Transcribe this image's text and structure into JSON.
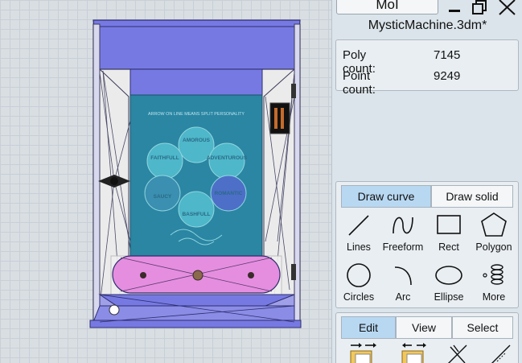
{
  "app": {
    "title_tab": "MoI",
    "document_title": "MysticMachine.3dm*"
  },
  "scene_info": {
    "poly_label": "Poly count:",
    "poly_value": "7145",
    "point_label": "Point count:",
    "point_value": "9249"
  },
  "draw_panel": {
    "tabs": [
      "Draw curve",
      "Draw solid"
    ],
    "active_tab": "Draw curve",
    "tools": [
      {
        "label": "Lines",
        "icon": "line-icon"
      },
      {
        "label": "Freeform",
        "icon": "freeform-icon"
      },
      {
        "label": "Rect",
        "icon": "rect-icon"
      },
      {
        "label": "Polygon",
        "icon": "polygon-icon"
      },
      {
        "label": "Circles",
        "icon": "circle-icon"
      },
      {
        "label": "Arc",
        "icon": "arc-icon"
      },
      {
        "label": "Ellipse",
        "icon": "ellipse-icon"
      },
      {
        "label": "More",
        "icon": "spiral-icon"
      }
    ]
  },
  "edit_panel": {
    "tabs": [
      "Edit",
      "View",
      "Select"
    ],
    "active_tab": "Edit"
  },
  "artwork": {
    "header": "ARROW ON LINE MEANS SPLIT PERSONALITY",
    "traits": [
      "AMOROUS",
      "FAITHFULL",
      "ADVENTUROUS",
      "SAUCY",
      "ROMANTIC",
      "BASHFULL"
    ]
  },
  "colors": {
    "cabinet_purple": "#7779e3",
    "panel_teal": "#2a86a3",
    "drawer_pink": "#e58ee0",
    "active_tab": "#b8d8f2"
  }
}
